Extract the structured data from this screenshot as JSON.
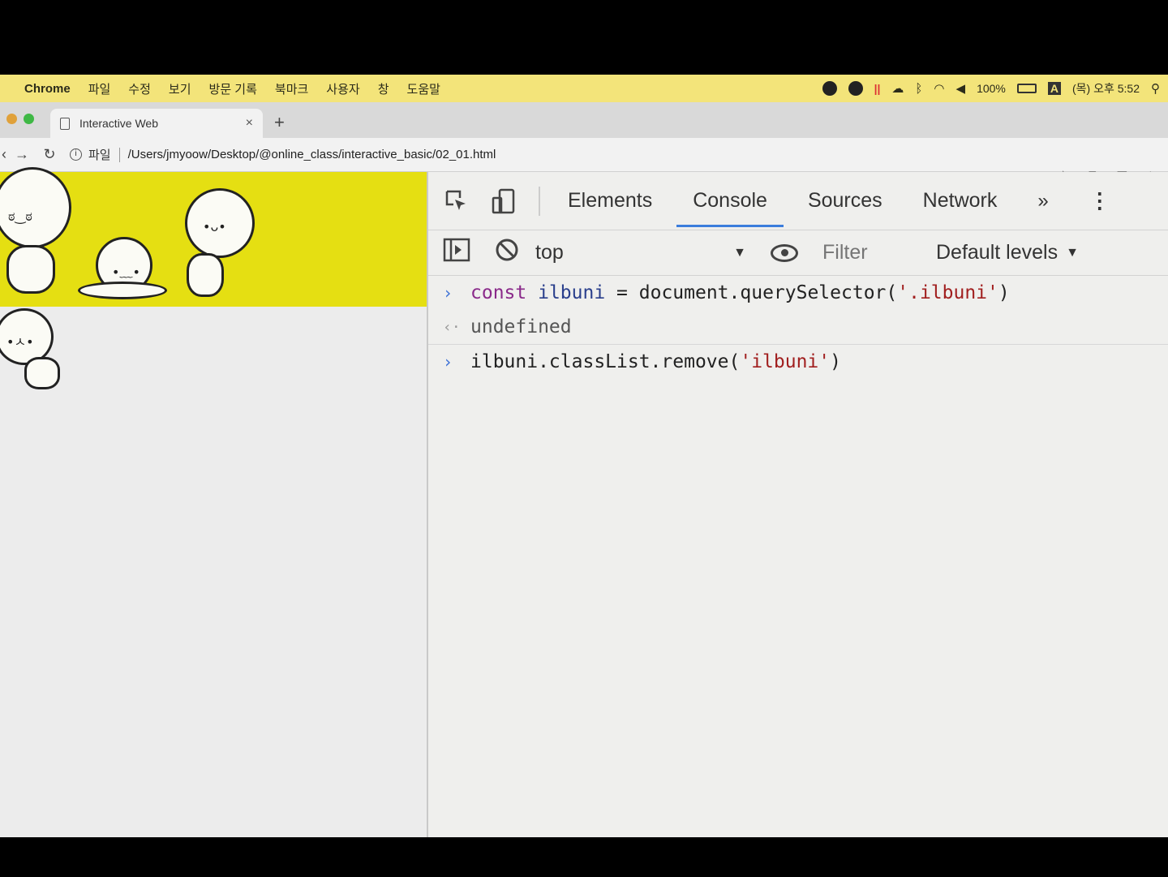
{
  "menubar": {
    "app": "Chrome",
    "items": [
      "파일",
      "수정",
      "보기",
      "방문 기록",
      "북마크",
      "사용자",
      "창",
      "도움말"
    ],
    "battery": "100%",
    "input_source": "A",
    "clock": "(목) 오후 5:52"
  },
  "browser": {
    "tab_title": "Interactive Web",
    "new_tab": "+",
    "tab_close": "×",
    "url_scheme": "파일",
    "url": "/Users/jmyoow/Desktop/@online_class/interactive_basic/02_01.html"
  },
  "devtools": {
    "tabs": [
      "Elements",
      "Console",
      "Sources",
      "Network"
    ],
    "active_tab": "Console",
    "more": "»",
    "context": "top",
    "filter_placeholder": "Filter",
    "levels": "Default levels",
    "console": [
      {
        "type": "input",
        "kw": "const",
        "var": "ilbuni",
        "op": " = ",
        "call": "document.querySelector(",
        "str": "'.ilbuni'",
        "close": ")"
      },
      {
        "type": "result",
        "text": "undefined"
      },
      {
        "type": "input",
        "call": "ilbuni.classList.remove(",
        "str": "'ilbuni'",
        "close": ")"
      }
    ]
  },
  "colors": {
    "menubar": "#f3e47a",
    "banner": "#e5df12",
    "active_tab_underline": "#3b7ddc",
    "prompt": "#3a6fd6",
    "string": "#a11f1f",
    "keyword": "#8a2a8a"
  }
}
